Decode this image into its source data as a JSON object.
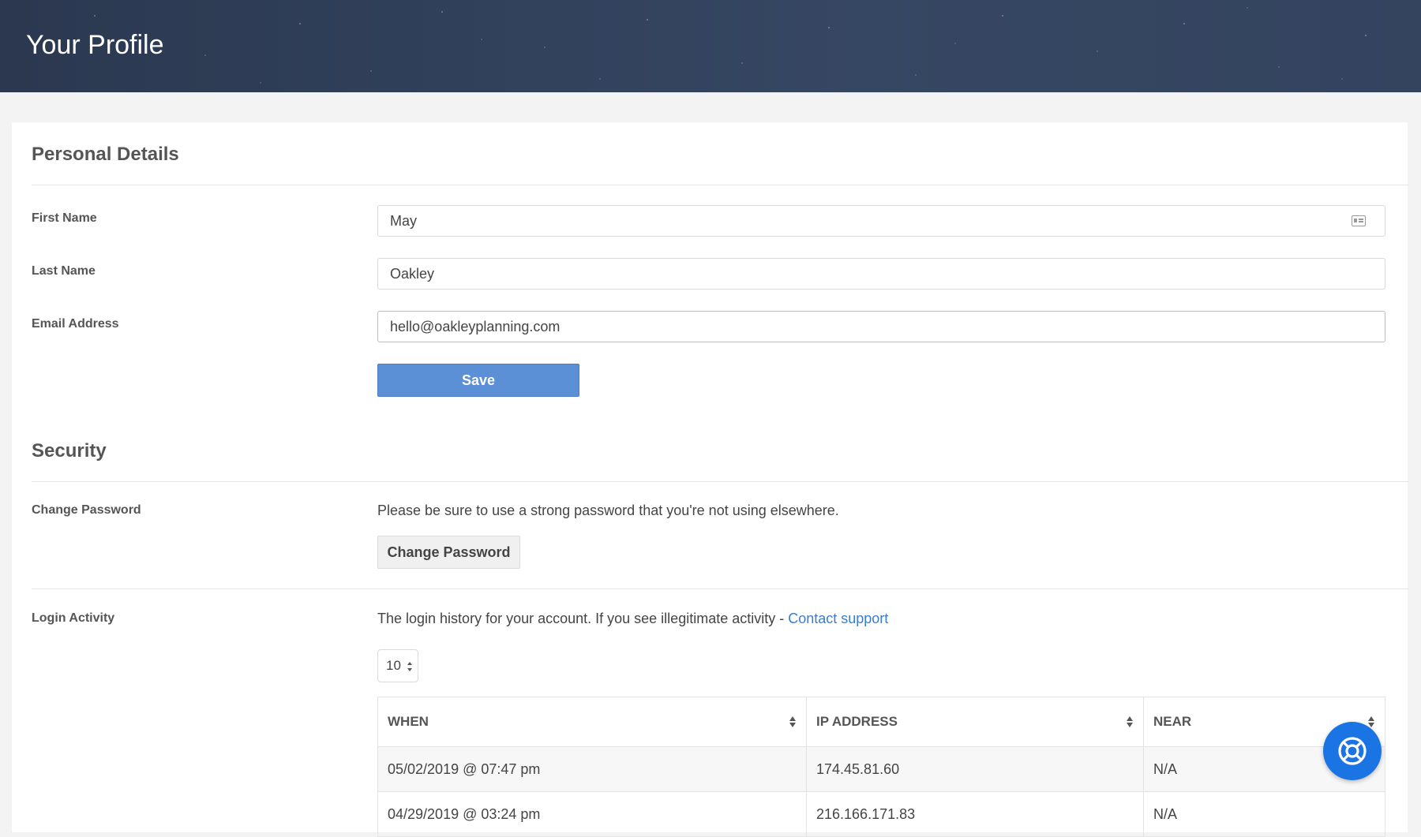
{
  "header": {
    "title": "Your Profile"
  },
  "personal": {
    "title": "Personal Details",
    "first_name_label": "First Name",
    "first_name_value": "May",
    "last_name_label": "Last Name",
    "last_name_value": "Oakley",
    "email_label": "Email Address",
    "email_value": "hello@oakleyplanning.com",
    "save_label": "Save"
  },
  "security": {
    "title": "Security",
    "change_password_label": "Change Password",
    "change_password_desc": "Please be sure to use a strong password that you're not using elsewhere.",
    "change_password_button": "Change Password",
    "login_activity_label": "Login Activity",
    "login_activity_desc": "The login history for your account. If you see illegitimate activity - ",
    "contact_support": "Contact support",
    "page_size": "10",
    "columns": [
      "WHEN",
      "IP ADDRESS",
      "NEAR"
    ],
    "rows": [
      [
        "05/02/2019 @ 07:47 pm",
        "174.45.81.60",
        "N/A"
      ],
      [
        "04/29/2019 @ 03:24 pm",
        "216.166.171.83",
        "N/A"
      ]
    ]
  },
  "icons": {
    "contact_card": "contact-card-icon",
    "sort": "sort-icon",
    "help": "lifebuoy-icon",
    "select_arrows": "select-arrows-icon"
  },
  "colors": {
    "header_bg": "#2f3d57",
    "primary": "#5b8fd6",
    "link": "#3b7ccf",
    "help_button": "#1b74e4"
  }
}
